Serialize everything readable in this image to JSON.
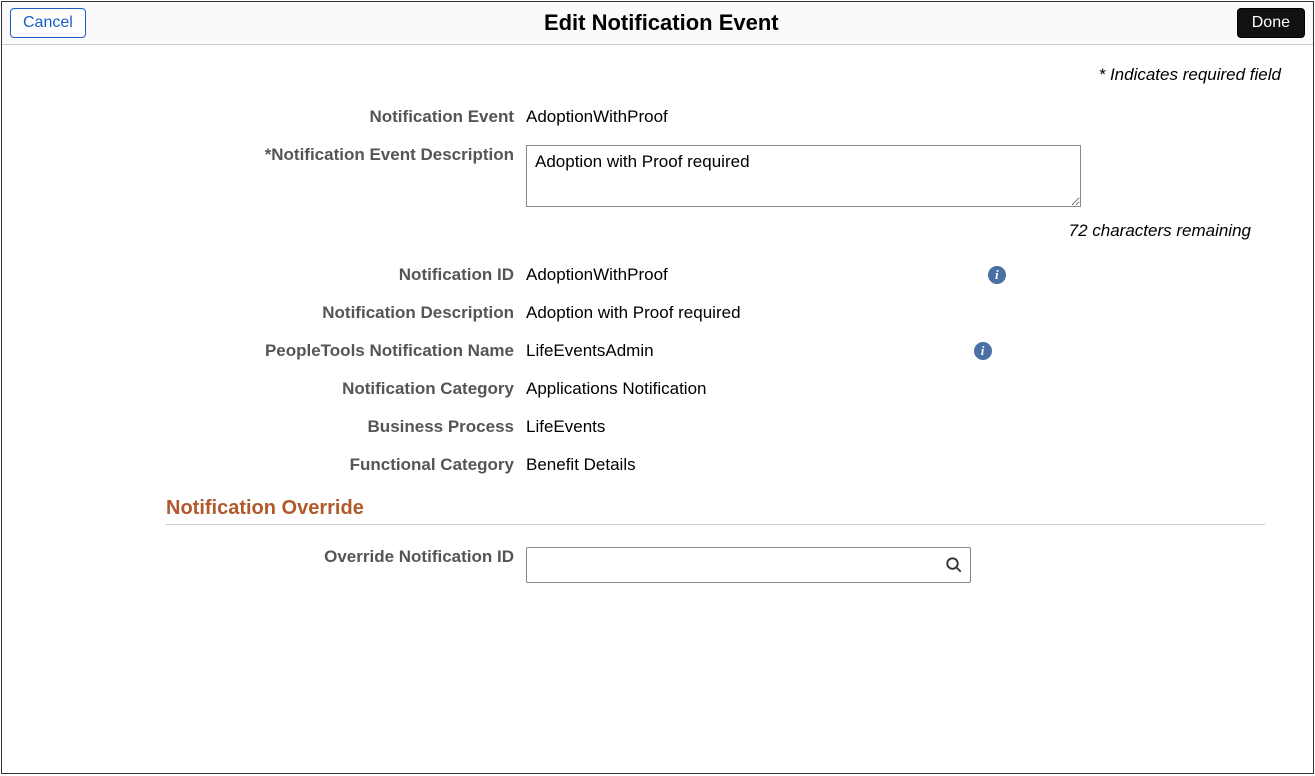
{
  "header": {
    "cancel_label": "Cancel",
    "title": "Edit Notification Event",
    "done_label": "Done"
  },
  "required_note": "* Indicates required field",
  "fields": {
    "notification_event": {
      "label": "Notification Event",
      "value": "AdoptionWithProof"
    },
    "notification_event_description": {
      "label": "*Notification Event Description",
      "value": "Adoption with Proof required"
    },
    "char_remaining": "72 characters remaining",
    "notification_id": {
      "label": "Notification ID",
      "value": "AdoptionWithProof"
    },
    "notification_description": {
      "label": "Notification Description",
      "value": "Adoption with Proof required"
    },
    "pt_notification_name": {
      "label": "PeopleTools Notification Name",
      "value": "LifeEventsAdmin"
    },
    "notification_category": {
      "label": "Notification Category",
      "value": "Applications Notification"
    },
    "business_process": {
      "label": "Business Process",
      "value": "LifeEvents"
    },
    "functional_category": {
      "label": "Functional Category",
      "value": "Benefit Details"
    }
  },
  "section": {
    "override_header": "Notification Override",
    "override_notification_id": {
      "label": "Override Notification ID",
      "value": ""
    }
  },
  "icons": {
    "info_glyph": "i"
  }
}
